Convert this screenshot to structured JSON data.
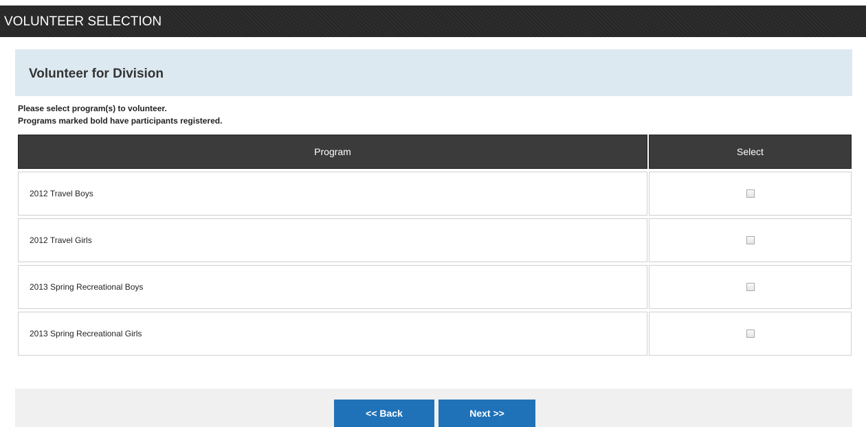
{
  "header": {
    "title": "VOLUNTEER SELECTION"
  },
  "section": {
    "heading": "Volunteer for Division"
  },
  "instructions": {
    "line1": "Please select program(s) to volunteer.",
    "line2": "Programs marked bold have participants registered."
  },
  "table": {
    "columns": {
      "program": "Program",
      "select": "Select"
    },
    "rows": [
      {
        "program": "2012 Travel Boys",
        "selected": false
      },
      {
        "program": "2012 Travel Girls",
        "selected": false
      },
      {
        "program": "2013 Spring Recreational Boys",
        "selected": false
      },
      {
        "program": "2013 Spring Recreational Girls",
        "selected": false
      }
    ]
  },
  "footer": {
    "back_label": "<< Back",
    "next_label": "Next >>"
  },
  "colors": {
    "title_bar": "#262626",
    "section_bg": "#dde9f1",
    "table_header": "#3b3b3b",
    "button": "#1f72b8",
    "footer_bg": "#f0f0f0"
  }
}
